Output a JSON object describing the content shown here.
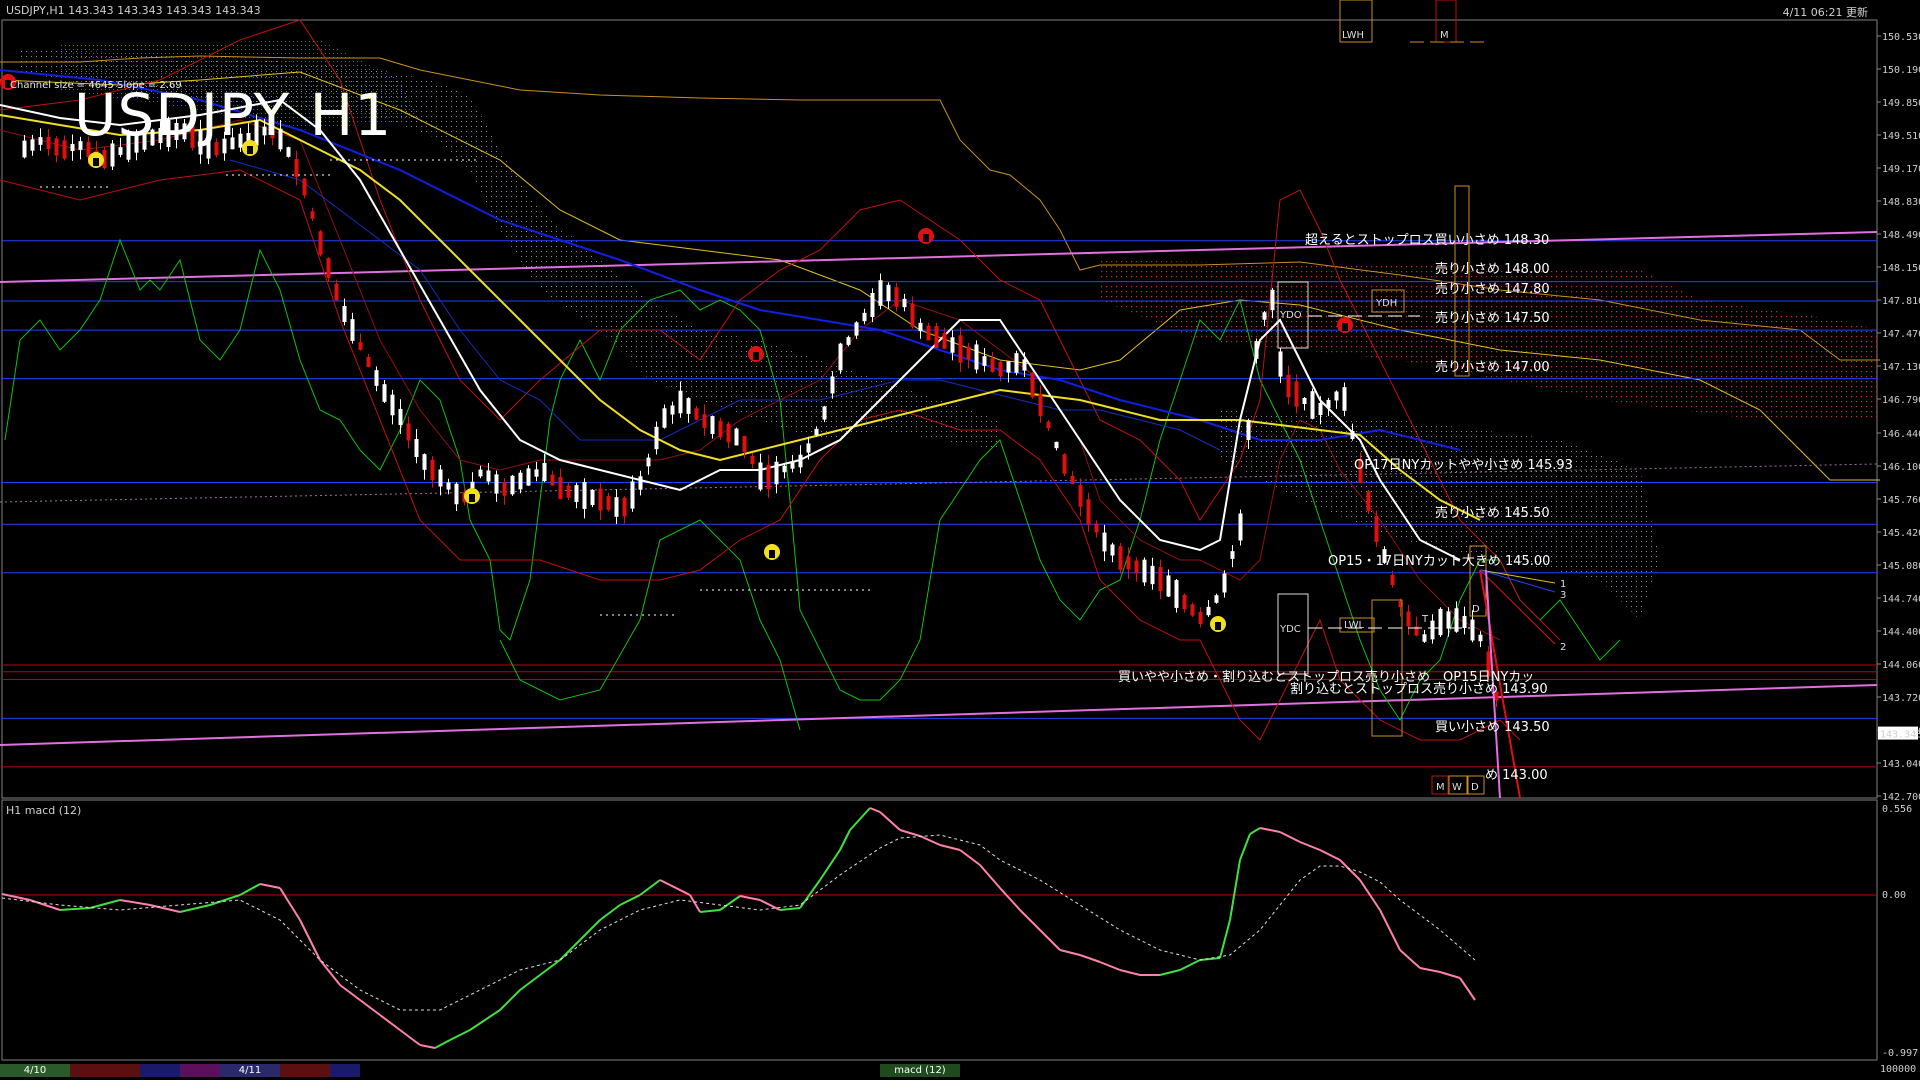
{
  "header": {
    "symbol_info": "USDJPY,H1  143.343 143.343 143.343 143.343",
    "timestamp": "4/11 06:21 更新"
  },
  "chart_title": "USDJPY H1",
  "channel_info": "Channel size = 4645 Slope = 2.69",
  "macd_label": "H1  macd (12)",
  "price_axis": [
    "150.530",
    "150.190",
    "149.850",
    "149.510",
    "149.170",
    "148.830",
    "148.490",
    "148.150",
    "147.810",
    "147.470",
    "147.130",
    "146.790",
    "146.440",
    "146.100",
    "145.760",
    "145.420",
    "145.080",
    "144.740",
    "144.400",
    "144.060",
    "143.720",
    "143.380",
    "143.040",
    "142.700"
  ],
  "current_price": "143.343",
  "macd_axis": {
    "top": "0.556",
    "zero": "0.00",
    "bottom": "-0.997",
    "scale": "100000"
  },
  "annotations": [
    {
      "text": "超えるとストップロス買い小さめ 148.30",
      "key": "a1"
    },
    {
      "text": "売り小さめ 148.00",
      "key": "a2"
    },
    {
      "text": "売り小さめ 147.80",
      "key": "a3"
    },
    {
      "text": "売り小さめ 147.50",
      "key": "a4"
    },
    {
      "text": "売り小さめ 147.00",
      "key": "a5"
    },
    {
      "text": "OP17日NYカットやや小さめ 145.93",
      "key": "a6"
    },
    {
      "text": "売り小さめ 145.50",
      "key": "a7"
    },
    {
      "text": "OP15・17日NYカット大きめ 145.00",
      "key": "a8"
    },
    {
      "text": "買いやや小さめ・割り込むとストップロス売り小さめ　OP15日NYカッ",
      "key": "a9"
    },
    {
      "text": "割り込むとストップロス売り小さめ 143.90",
      "key": "a10"
    },
    {
      "text": "買い小さめ 143.50",
      "key": "a11"
    },
    {
      "text": "め 143.00",
      "key": "a12"
    }
  ],
  "box_labels": {
    "ydo": "YDO",
    "ydc": "YDC",
    "ydh": "YDH",
    "lwl": "LWL",
    "lwh": "LWH",
    "m": "M",
    "w": "W",
    "d": "D",
    "t": "T"
  },
  "line_markers": {
    "one": "1",
    "two": "2",
    "three": "3"
  },
  "bottom_tabs": [
    {
      "label": "4/10",
      "color": "#2a5a2a"
    },
    {
      "label": "",
      "color": "#5a1010"
    },
    {
      "label": "",
      "color": "#1a1a6a"
    },
    {
      "label": "",
      "color": "#5a105a"
    },
    {
      "label": "4/11",
      "color": "#2a2a6a"
    },
    {
      "label": "",
      "color": "#5a1010"
    },
    {
      "label": "",
      "color": "#1a1a6a"
    },
    {
      "label": "macd (12)",
      "color": "#1e4a1e"
    }
  ],
  "colors": {
    "bull": "#ffffff",
    "bear": "#e01010",
    "white_ma": "#ffffff",
    "yellow_ma": "#f0e020",
    "blue_ma": "#1020e0",
    "bollinger": "#c01010",
    "green_line": "#10c010",
    "pink_line": "#e070e0",
    "cloud": "#c08020",
    "hline_blue": "#2040ff",
    "hline_red": "#c00000",
    "macd_up": "#40e040",
    "macd_down": "#ff80b0"
  }
}
